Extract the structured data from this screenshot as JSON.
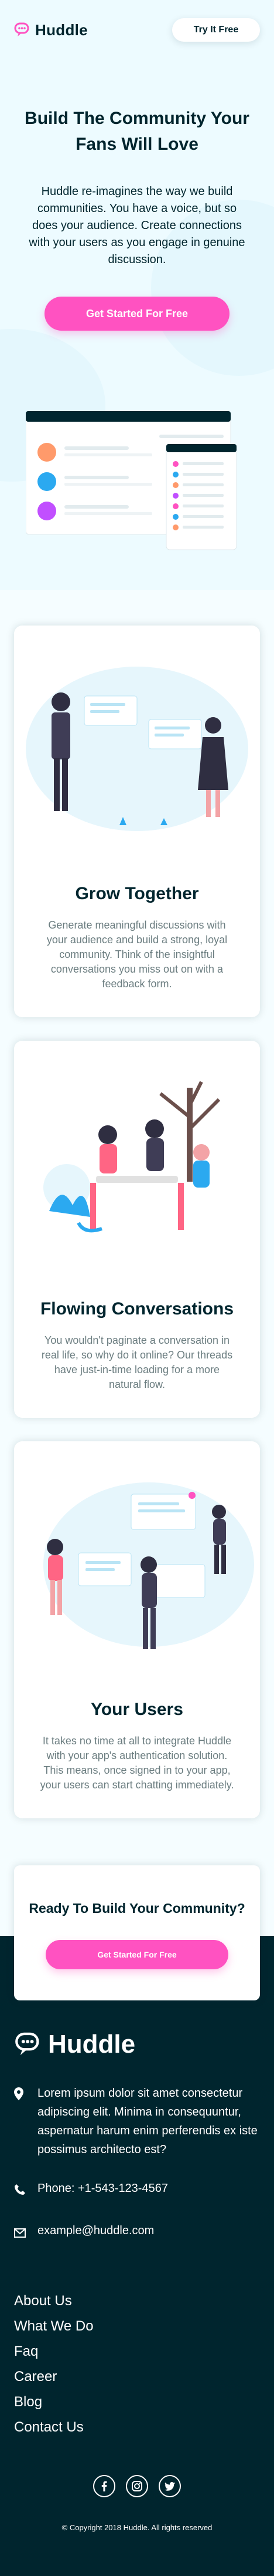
{
  "brand": {
    "name": "Huddle",
    "accent": "#ff52c1",
    "dark": "#00252e"
  },
  "header": {
    "try_label": "Try It Free"
  },
  "hero": {
    "title": "Build The Community Your Fans Will Love",
    "description": "Huddle re-imagines the way we build communities. You have a voice, but so does your audience. Create connections with your users as you engage in genuine discussion.",
    "cta_label": "Get Started For Free"
  },
  "features": [
    {
      "title": "Grow Together",
      "text": "Generate meaningful discussions with your audience and build a strong, loyal community. Think of the insightful conversations you miss out on with a feedback form."
    },
    {
      "title": "Flowing Conversations",
      "text": "You wouldn't paginate a conversation in real life, so why do it online? Our threads have just-in-time loading for a more natural flow."
    },
    {
      "title": "Your Users",
      "text": "It takes no time at all to integrate Huddle with your app's authentication solution. This means, once signed in to your app, your users can start chatting immediately."
    }
  ],
  "ready": {
    "title": "Ready To Build Your Community?",
    "cta_label": "Get Started For Free"
  },
  "footer": {
    "address": "Lorem ipsum dolor sit amet consectetur adipiscing elit. Minima in consequuntur, aspernatur harum enim perferendis ex iste possimus architecto est?",
    "phone": "Phone: +1-543-123-4567",
    "email": "example@huddle.com",
    "links": [
      "About Us",
      "What We Do",
      "Faq",
      "Career",
      "Blog",
      "Contact Us"
    ],
    "copyright": "© Copyright 2018 Huddle. All rights reserved",
    "social_icons": [
      "facebook-icon",
      "instagram-icon",
      "twitter-icon"
    ]
  }
}
